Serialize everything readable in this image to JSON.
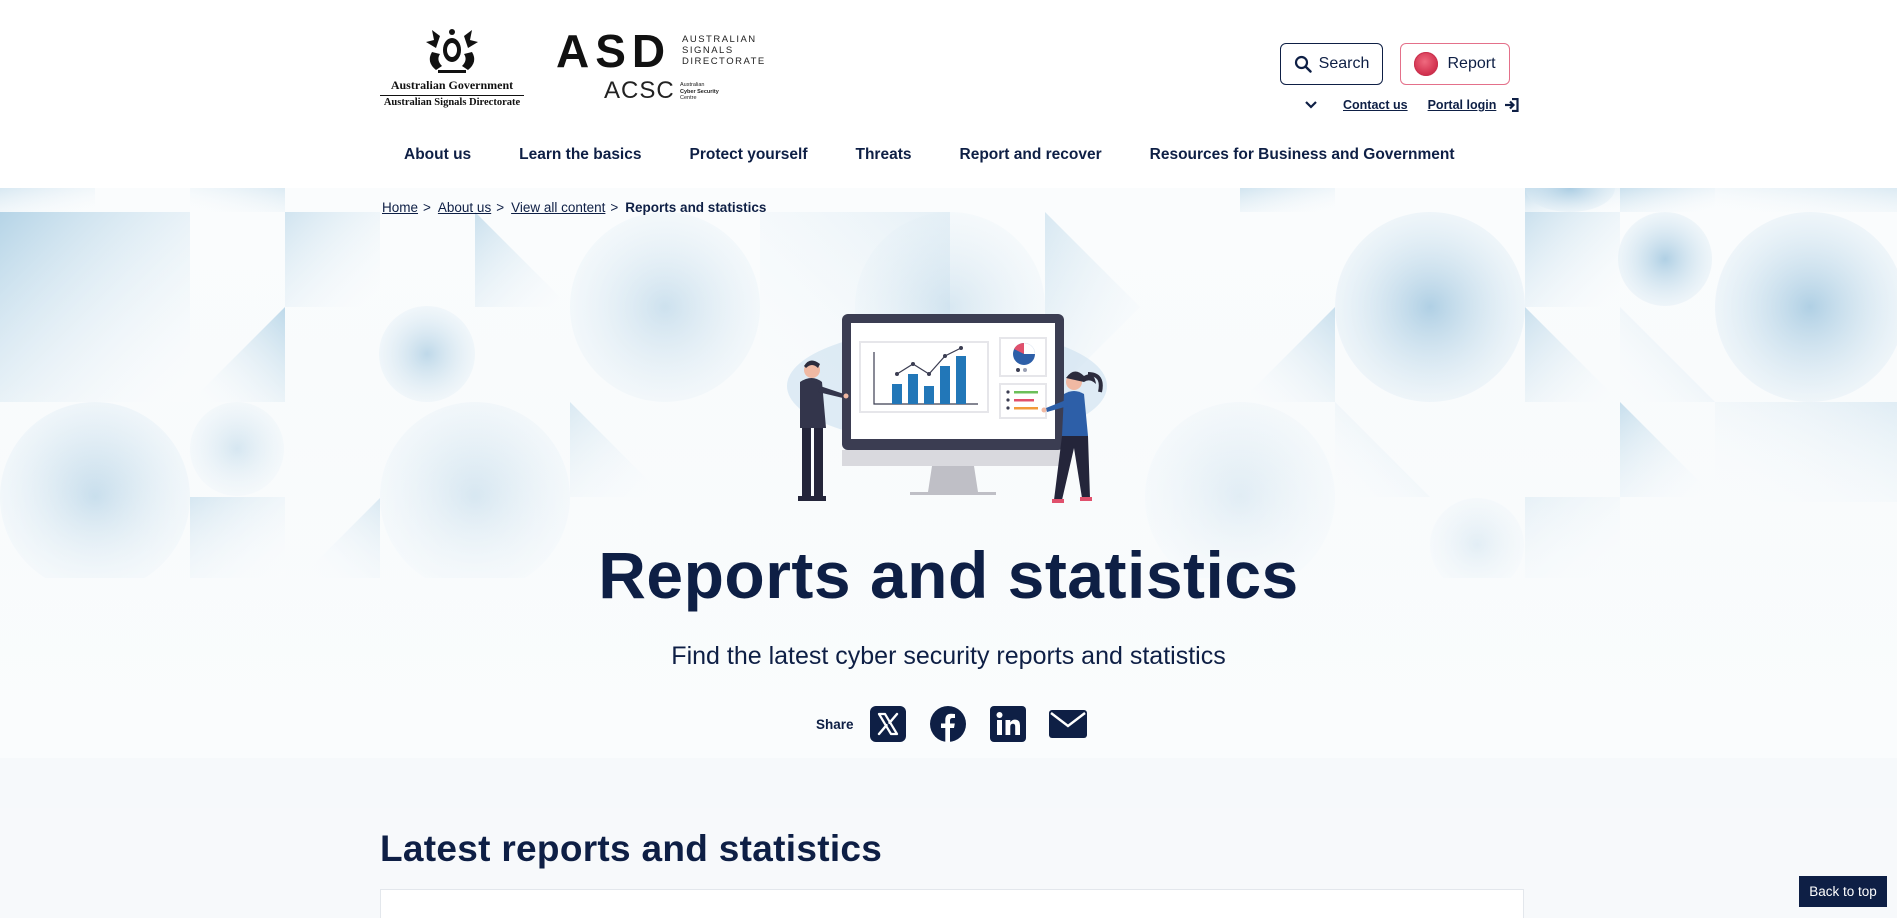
{
  "header": {
    "gov_logo": {
      "line1": "Australian Government",
      "line2": "Australian Signals Directorate"
    },
    "asd_logo": {
      "letters": "ASD",
      "sub": [
        "AUSTRALIAN",
        "SIGNALS",
        "DIRECTORATE"
      ],
      "acsc": "ACSC",
      "acsc_sub": [
        "Australian",
        "Cyber Security",
        "Centre"
      ]
    },
    "search_label": "Search",
    "report_label": "Report",
    "contact_label": "Contact us",
    "portal_label": "Portal login"
  },
  "nav": {
    "items": [
      {
        "label": "About us"
      },
      {
        "label": "Learn the basics"
      },
      {
        "label": "Protect yourself"
      },
      {
        "label": "Threats"
      },
      {
        "label": "Report and recover"
      },
      {
        "label": "Resources for Business and Government"
      }
    ]
  },
  "breadcrumb": {
    "items": [
      {
        "label": "Home"
      },
      {
        "label": "About us"
      },
      {
        "label": "View all content"
      }
    ],
    "separator": ">",
    "current": "Reports and statistics"
  },
  "hero": {
    "title": "Reports and statistics",
    "subtitle": "Find the latest cyber security reports and statistics",
    "share_label": "Share",
    "share_icons": [
      "x-icon",
      "facebook-icon",
      "linkedin-icon",
      "email-icon"
    ]
  },
  "section": {
    "title": "Latest reports and statistics"
  },
  "back_to_top_label": "Back to top",
  "colors": {
    "navy": "#0e1f45",
    "report_border": "#e4708a",
    "pattern_blue": "#9fc7df",
    "chart_blue": "#2277b8"
  }
}
